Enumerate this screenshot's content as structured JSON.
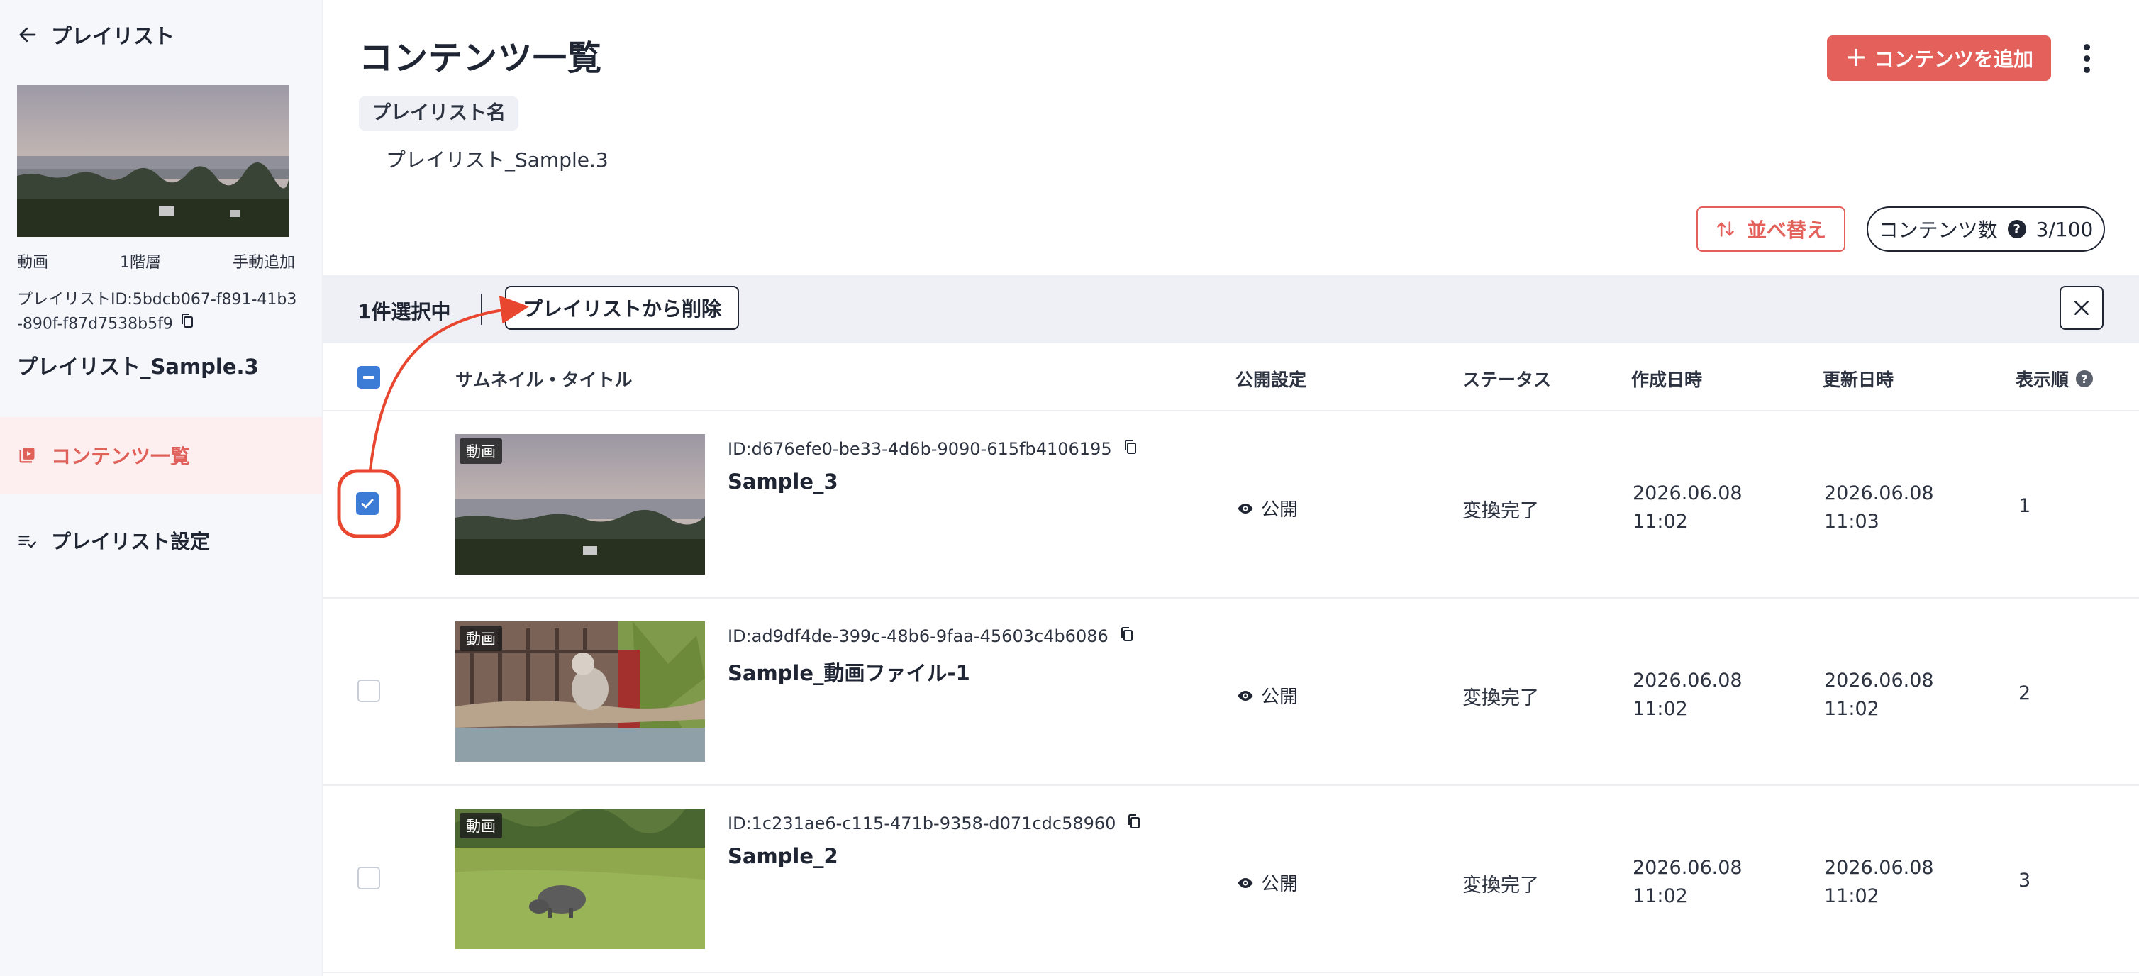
{
  "sidebar": {
    "back_label": "プレイリスト",
    "meta": [
      "動画",
      "1階層",
      "手動追加"
    ],
    "playlist_id": "プレイリストID:5bdcb067-f891-41b3-890f-f87d7538b5f9",
    "playlist_name": "プレイリスト_Sample.3",
    "nav": [
      {
        "label": "コンテンツ一覧",
        "active": true
      },
      {
        "label": "プレイリスト設定",
        "active": false
      }
    ]
  },
  "header": {
    "title": "コンテンツ一覧",
    "add_button": "コンテンツを追加",
    "playlist_label": "プレイリスト名",
    "playlist_value": "プレイリスト_Sample.3"
  },
  "toolbar": {
    "sort_label": "並べ替え",
    "count_label": "コンテンツ数",
    "count_value": "3/100"
  },
  "selection": {
    "count_text": "1件選択中",
    "remove_button": "プレイリストから削除"
  },
  "table": {
    "columns": [
      "サムネイル・タイトル",
      "公開設定",
      "ステータス",
      "作成日時",
      "更新日時",
      "表示順"
    ],
    "rows": [
      {
        "badge": "動画",
        "id": "ID:d676efe0-be33-4d6b-9090-615fb4106195",
        "title": "Sample_3",
        "publish": "公開",
        "status": "変換完了",
        "created_date": "2026.06.08",
        "created_time": "11:02",
        "updated_date": "2026.06.08",
        "updated_time": "11:03",
        "order": "1",
        "checked": true
      },
      {
        "badge": "動画",
        "id": "ID:ad9df4de-399c-48b6-9faa-45603c4b6086",
        "title": "Sample_動画ファイル-1",
        "publish": "公開",
        "status": "変換完了",
        "created_date": "2026.06.08",
        "created_time": "11:02",
        "updated_date": "2026.06.08",
        "updated_time": "11:02",
        "order": "2",
        "checked": false
      },
      {
        "badge": "動画",
        "id": "ID:1c231ae6-c115-471b-9358-d071cdc58960",
        "title": "Sample_2",
        "publish": "公開",
        "status": "変換完了",
        "created_date": "2026.06.08",
        "created_time": "11:02",
        "updated_date": "2026.06.08",
        "updated_time": "11:02",
        "order": "3",
        "checked": false
      }
    ]
  },
  "icons": {
    "back": "arrow-left-icon",
    "copy": "copy-icon",
    "contents": "video-library-icon",
    "settings": "playlist-check-icon",
    "sort": "sort-arrows-icon",
    "help": "question-circle-icon",
    "publish": "eye-icon",
    "close": "close-icon"
  },
  "colors": {
    "accent": "#e3605b",
    "checkbox": "#3c7bd6",
    "sidebar_bg": "#f6f7fb",
    "active_nav_bg": "#fdeff0",
    "selection_bar_bg": "#eef0f5"
  }
}
